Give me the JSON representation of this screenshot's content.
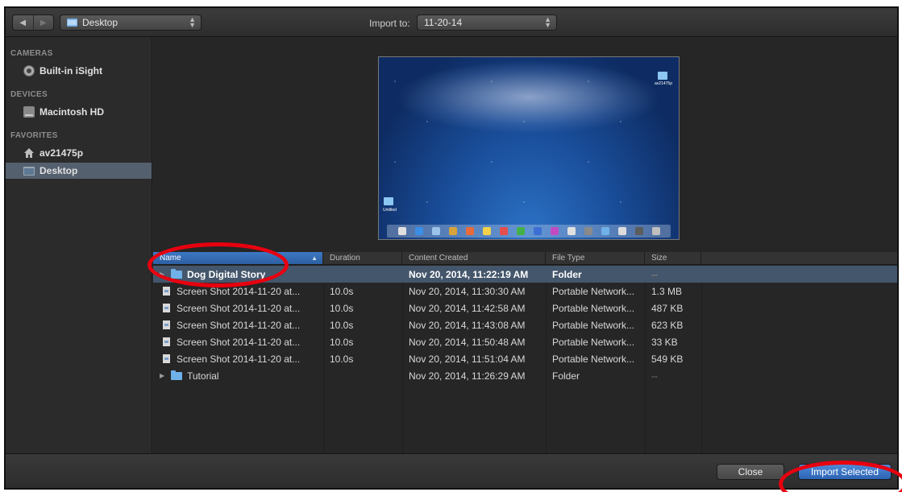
{
  "toolbar": {
    "back_icon": "◀",
    "forward_icon": "▶",
    "location": "Desktop",
    "import_to_label": "Import to:",
    "import_to_value": "11-20-14"
  },
  "sidebar": {
    "sections": [
      {
        "heading": "CAMERAS",
        "items": [
          {
            "label": "Built-in iSight",
            "icon": "camera-icon"
          }
        ]
      },
      {
        "heading": "DEVICES",
        "items": [
          {
            "label": "Macintosh HD",
            "icon": "hard-drive-icon"
          }
        ]
      },
      {
        "heading": "FAVORITES",
        "items": [
          {
            "label": "av21475p",
            "icon": "home-icon"
          },
          {
            "label": "Desktop",
            "icon": "desktop-icon",
            "selected": true
          }
        ]
      }
    ]
  },
  "preview": {
    "desktop_folder_label": "av21475p",
    "desktop_folder2_label": "Untitled"
  },
  "list": {
    "headers": [
      "Name",
      "Duration",
      "Content Created",
      "File Type",
      "Size"
    ],
    "rows": [
      {
        "name": "Dog Digital Story",
        "duration": "",
        "created": "Nov 20, 2014, 11:22:19 AM",
        "type": "Folder",
        "size": "--",
        "kind": "folder",
        "selected": true
      },
      {
        "name": "Screen Shot 2014-11-20 at...",
        "duration": "10.0s",
        "created": "Nov 20, 2014, 11:30:30 AM",
        "type": "Portable Network...",
        "size": "1.3 MB",
        "kind": "file"
      },
      {
        "name": "Screen Shot 2014-11-20 at...",
        "duration": "10.0s",
        "created": "Nov 20, 2014, 11:42:58 AM",
        "type": "Portable Network...",
        "size": "487 KB",
        "kind": "file"
      },
      {
        "name": "Screen Shot 2014-11-20 at...",
        "duration": "10.0s",
        "created": "Nov 20, 2014, 11:43:08 AM",
        "type": "Portable Network...",
        "size": "623 KB",
        "kind": "file"
      },
      {
        "name": "Screen Shot 2014-11-20 at...",
        "duration": "10.0s",
        "created": "Nov 20, 2014, 11:50:48 AM",
        "type": "Portable Network...",
        "size": "33 KB",
        "kind": "file"
      },
      {
        "name": "Screen Shot 2014-11-20 at...",
        "duration": "10.0s",
        "created": "Nov 20, 2014, 11:51:04 AM",
        "type": "Portable Network...",
        "size": "549 KB",
        "kind": "file"
      },
      {
        "name": "Tutorial",
        "duration": "",
        "created": "Nov 20, 2014, 11:26:29 AM",
        "type": "Folder",
        "size": "--",
        "kind": "folder"
      }
    ]
  },
  "buttons": {
    "close": "Close",
    "import_selected": "Import Selected"
  },
  "colors": {
    "annotation_red": "#e8000f",
    "selection_blue": "#44566b",
    "primary_button": "#2c63b4"
  }
}
